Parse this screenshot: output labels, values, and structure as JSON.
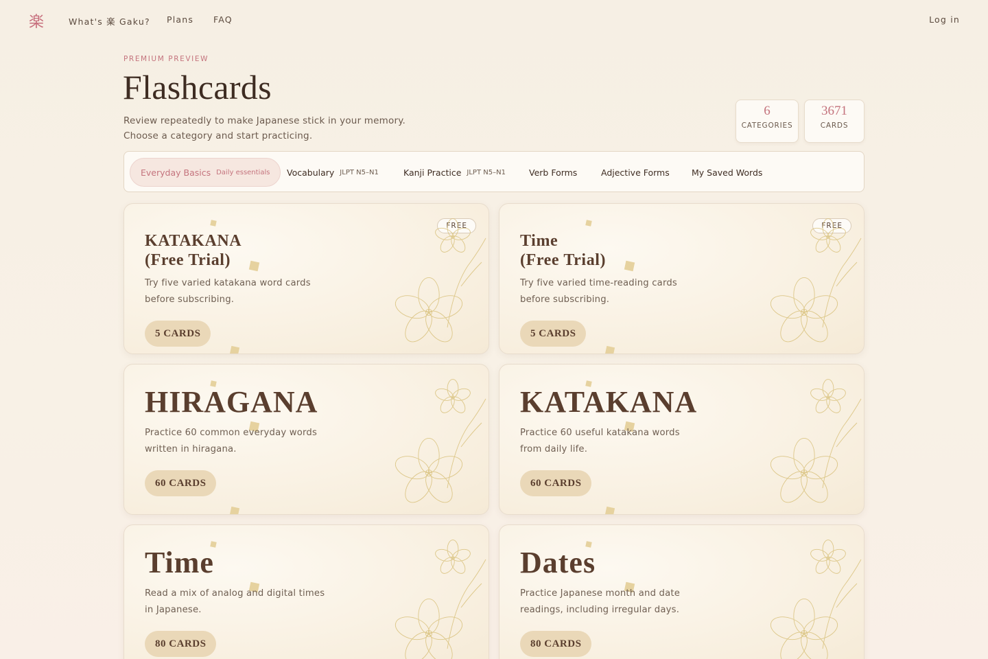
{
  "nav": {
    "logo": "楽",
    "links": [
      "What's 楽 Gaku?",
      "Plans",
      "FAQ"
    ],
    "login": "Log in"
  },
  "header": {
    "eyebrow": "PREMIUM PREVIEW",
    "title": "Flashcards",
    "subtitle_line1": "Review repeatedly to make Japanese stick in your memory.",
    "subtitle_line2": "Choose a category and start practicing."
  },
  "stats": [
    {
      "value": "6",
      "label": "CATEGORIES"
    },
    {
      "value": "3671",
      "label": "CARDS"
    }
  ],
  "tabs": [
    {
      "label": "Everyday Basics",
      "sub": "Daily essentials",
      "active": true
    },
    {
      "label": "Vocabulary",
      "sub": "JLPT N5–N1"
    },
    {
      "label": "Kanji Practice",
      "sub": "JLPT N5–N1"
    },
    {
      "label": "Verb Forms",
      "sub": ""
    },
    {
      "label": "Adjective Forms",
      "sub": ""
    },
    {
      "label": "My Saved Words",
      "sub": ""
    }
  ],
  "cards": [
    {
      "title_line1": "KATAKANA",
      "title_line2": "(Free Trial)",
      "desc_line1": "Try five varied katakana word cards",
      "desc_line2": "before subscribing.",
      "count": "5 CARDS",
      "badge": "FREE"
    },
    {
      "title_line1": "Time",
      "title_line2": "(Free Trial)",
      "desc_line1": "Try five varied time-reading cards",
      "desc_line2": "before subscribing.",
      "count": "5 CARDS",
      "badge": "FREE"
    },
    {
      "title": "HIRAGANA",
      "desc_line1": "Practice 60 common everyday words",
      "desc_line2": "written in hiragana.",
      "count": "60 CARDS"
    },
    {
      "title": "KATAKANA",
      "desc_line1": "Practice 60 useful katakana words",
      "desc_line2": "from daily life.",
      "count": "60 CARDS"
    },
    {
      "title": "Time",
      "desc_line1": "Read a mix of analog and digital times",
      "desc_line2": "in Japanese.",
      "count": "80 CARDS"
    },
    {
      "title": "Dates",
      "desc_line1": "Practice Japanese month and date",
      "desc_line2": "readings, including irregular days.",
      "count": "80 CARDS"
    }
  ],
  "colors": {
    "accent": "#c4737d",
    "heading": "#3e2c22",
    "pill": "#ead8b8",
    "background": "#f6efe4"
  }
}
